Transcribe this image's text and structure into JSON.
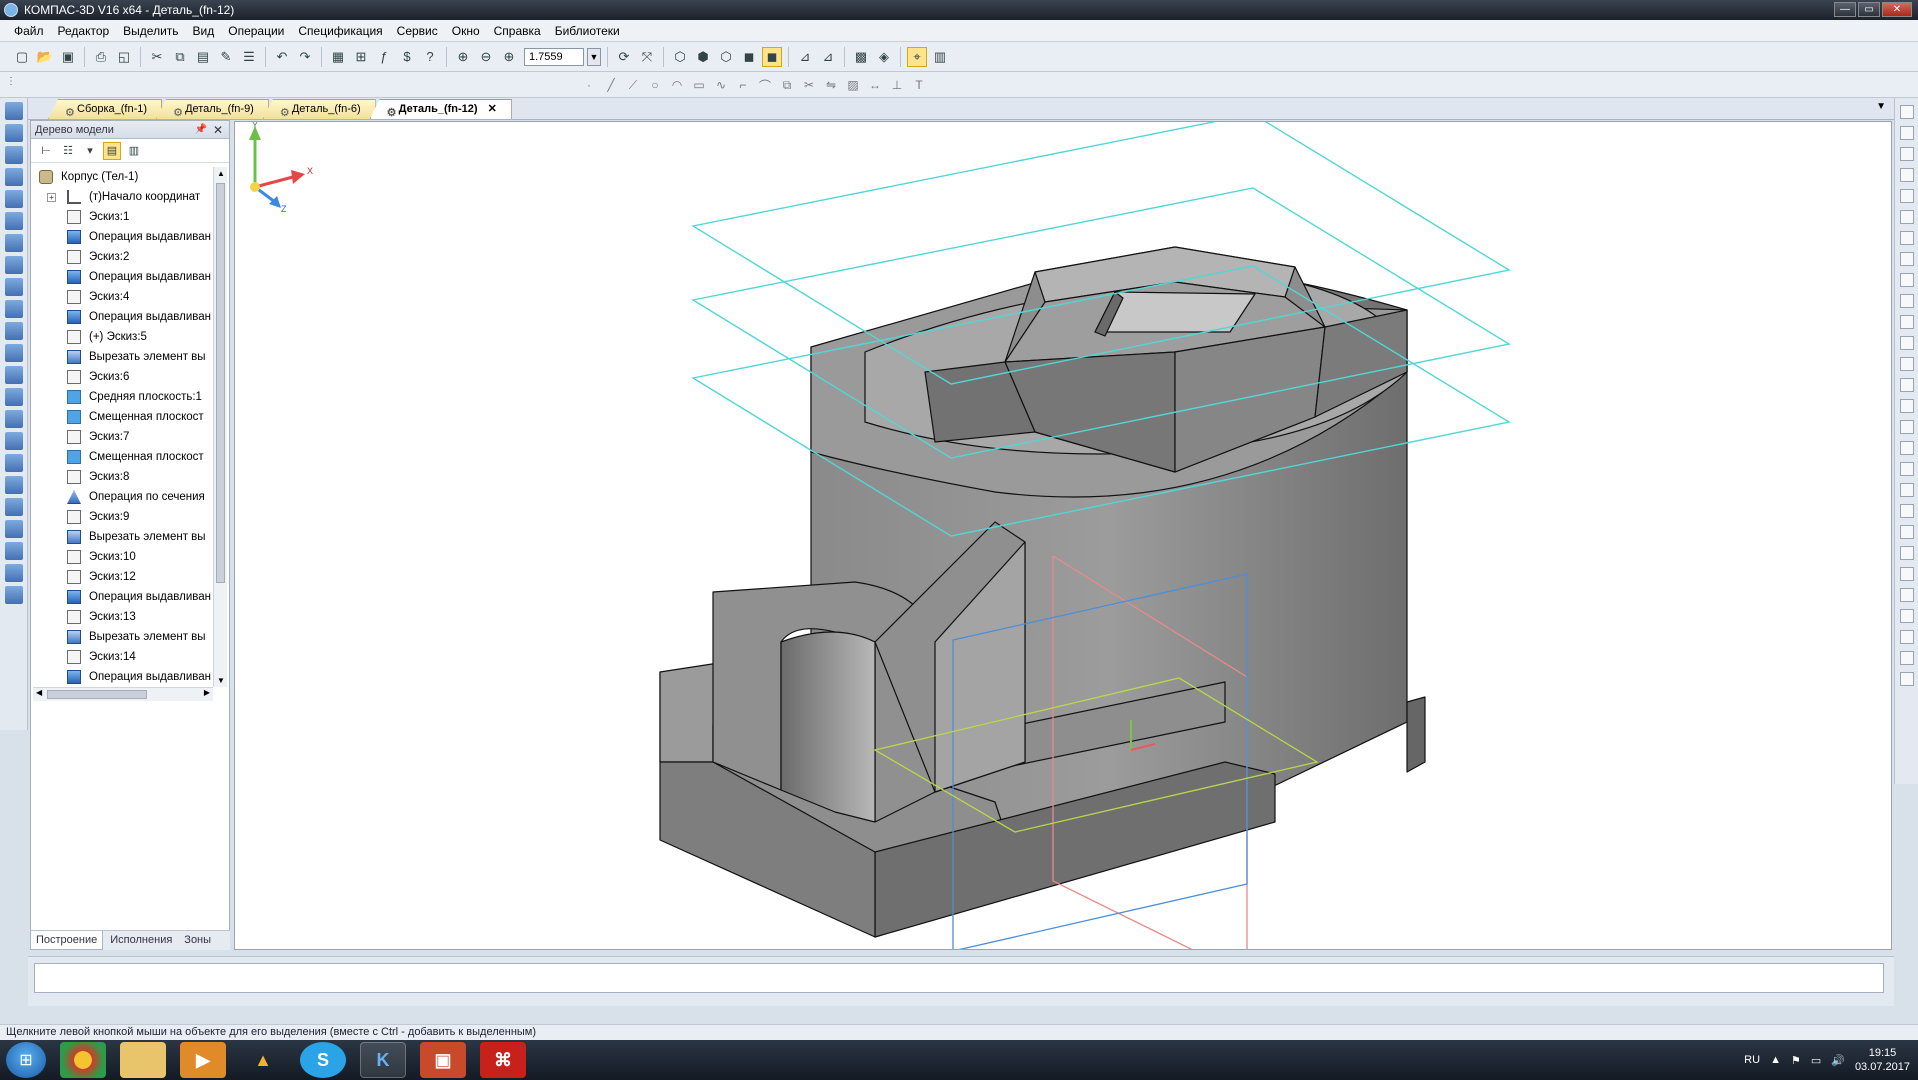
{
  "window": {
    "title": "КОМПАС-3D V16  x64 - Деталь_(fn-12)",
    "controls": [
      "minimize",
      "maximize",
      "close"
    ]
  },
  "menu": [
    "Файл",
    "Редактор",
    "Выделить",
    "Вид",
    "Операции",
    "Спецификация",
    "Сервис",
    "Окно",
    "Справка",
    "Библиотеки"
  ],
  "toolbar": {
    "zoom_value": "1.7559"
  },
  "tabs": [
    {
      "label": "Сборка_(fn-1)",
      "active": false
    },
    {
      "label": "Деталь_(fn-9)",
      "active": false
    },
    {
      "label": "Деталь_(fn-6)",
      "active": false
    },
    {
      "label": "Деталь_(fn-12)",
      "active": true
    }
  ],
  "tree": {
    "header": "Дерево модели",
    "root": "Корпус (Тел-1)",
    "items": [
      {
        "label": "(т)Начало координат",
        "kind": "ax"
      },
      {
        "label": "Эскиз:1",
        "kind": "sk"
      },
      {
        "label": "Операция выдавливан",
        "kind": "op"
      },
      {
        "label": "Эскиз:2",
        "kind": "sk"
      },
      {
        "label": "Операция выдавливан",
        "kind": "op"
      },
      {
        "label": "Эскиз:4",
        "kind": "sk"
      },
      {
        "label": "Операция выдавливан",
        "kind": "op"
      },
      {
        "label": "(+) Эскиз:5",
        "kind": "sk"
      },
      {
        "label": "Вырезать элемент вы",
        "kind": "cut"
      },
      {
        "label": "Эскиз:6",
        "kind": "sk"
      },
      {
        "label": "Средняя плоскость:1",
        "kind": "pl"
      },
      {
        "label": "Смещенная плоскост",
        "kind": "pl"
      },
      {
        "label": "Эскиз:7",
        "kind": "sk"
      },
      {
        "label": "Смещенная плоскост",
        "kind": "pl"
      },
      {
        "label": "Эскиз:8",
        "kind": "sk"
      },
      {
        "label": "Операция по сечения",
        "kind": "lo"
      },
      {
        "label": "Эскиз:9",
        "kind": "sk"
      },
      {
        "label": "Вырезать элемент вы",
        "kind": "cut"
      },
      {
        "label": "Эскиз:10",
        "kind": "sk"
      },
      {
        "label": "Эскиз:12",
        "kind": "sk"
      },
      {
        "label": "Операция выдавливан",
        "kind": "op"
      },
      {
        "label": "Эскиз:13",
        "kind": "sk"
      },
      {
        "label": "Вырезать элемент вы",
        "kind": "cut"
      },
      {
        "label": "Эскиз:14",
        "kind": "sk"
      },
      {
        "label": "Операция выдавливан",
        "kind": "op"
      }
    ],
    "bottom_tabs": [
      "Построение",
      "Исполнения",
      "Зоны"
    ]
  },
  "viewport": {
    "axis_labels": {
      "x": "X",
      "y": "Y",
      "z": "Z"
    },
    "colors": {
      "plane": "#52d6d6",
      "body": "#8e8e8e",
      "sketch_red": "#e88a8a",
      "sketch_blue": "#4a8fd8",
      "sketch_green": "#b8d84a"
    }
  },
  "status": "Щелкните левой кнопкой мыши на объекте для его выделения (вместе с Ctrl - добавить к выделенным)",
  "taskbar": {
    "apps": [
      "chrome-icon",
      "explorer-icon",
      "media-player-icon",
      "aimp-icon",
      "skype-icon",
      "kompas-icon",
      "presentation-icon",
      "pdf-icon"
    ],
    "language": "RU",
    "time": "19:15",
    "date": "03.07.2017"
  }
}
